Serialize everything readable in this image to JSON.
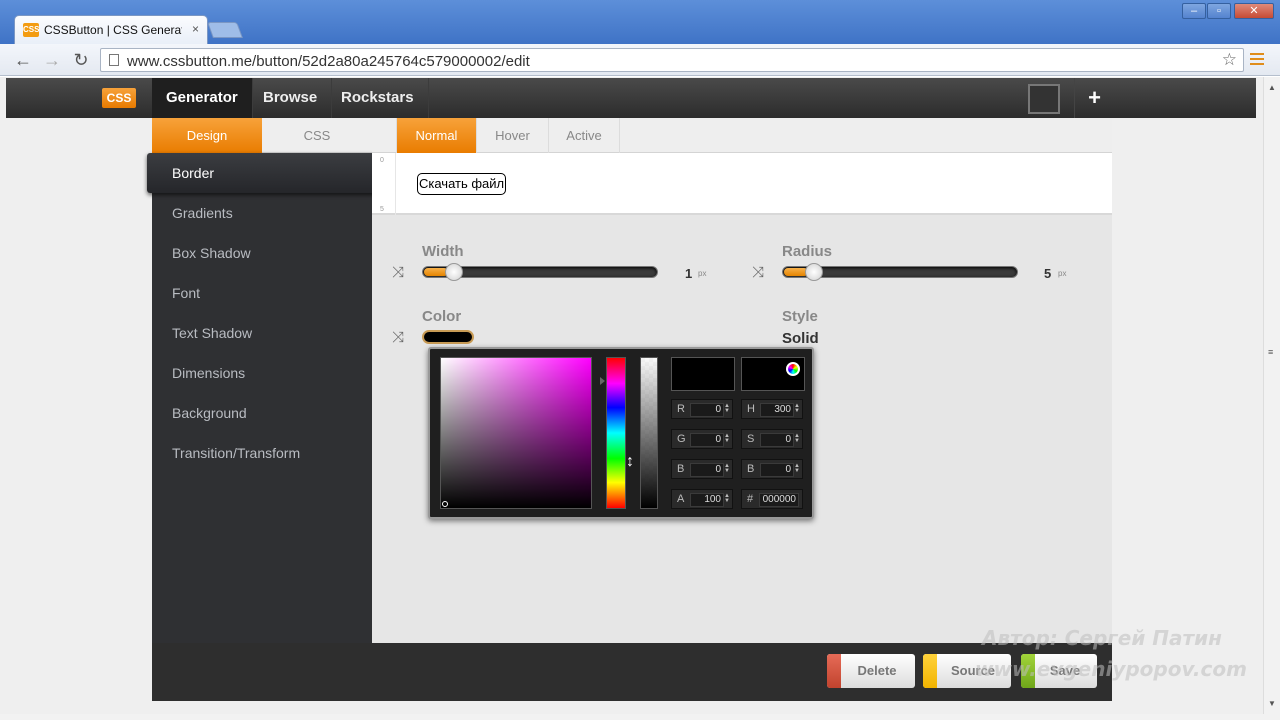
{
  "browser": {
    "tab_title": "CSSButton | CSS Generato",
    "url": "www.cssbutton.me/button/52d2a80a245764c579000002/edit",
    "tab_close": "×",
    "win_min": "–",
    "win_max": "▫",
    "win_close": "✕",
    "back": "←",
    "forward": "→",
    "reload": "↻",
    "star": "☆"
  },
  "site": {
    "logo": "CSS",
    "nav": [
      "Generator",
      "Browse",
      "Rockstars"
    ],
    "plus": "+"
  },
  "mode_tabs": [
    "Design",
    "CSS"
  ],
  "state_tabs": [
    "Normal",
    "Hover",
    "Active"
  ],
  "sidebar": {
    "items": [
      "Border",
      "Gradients",
      "Box Shadow",
      "Font",
      "Text Shadow",
      "Dimensions",
      "Background",
      "Transition/Transform"
    ]
  },
  "preview": {
    "ruler": [
      "0",
      "5"
    ],
    "button_text": "Скачать файл"
  },
  "controls": {
    "width_label": "Width",
    "width_value": "1",
    "width_level": 0.06,
    "radius_label": "Radius",
    "radius_value": "5",
    "radius_level": 0.06,
    "unit": "px",
    "color_label": "Color",
    "style_label": "Style",
    "style_value": "Solid",
    "shuffle": "⤨"
  },
  "picker": {
    "fields": [
      {
        "label": "R",
        "value": "0"
      },
      {
        "label": "H",
        "value": "300"
      },
      {
        "label": "G",
        "value": "0"
      },
      {
        "label": "S",
        "value": "0"
      },
      {
        "label": "B",
        "value": "0"
      },
      {
        "label": "B",
        "value": "0"
      },
      {
        "label": "A",
        "value": "100"
      },
      {
        "label": "#",
        "value": "000000"
      }
    ],
    "cursor": "↕"
  },
  "footer": {
    "delete": "Delete",
    "source": "Source",
    "save": "Save"
  },
  "watermark": {
    "line1": "Автор: Сергей Патин",
    "line2": "www.evgeniypopov.com"
  },
  "colors": {
    "accent": "#f39c12",
    "dark": "#2f3033"
  }
}
